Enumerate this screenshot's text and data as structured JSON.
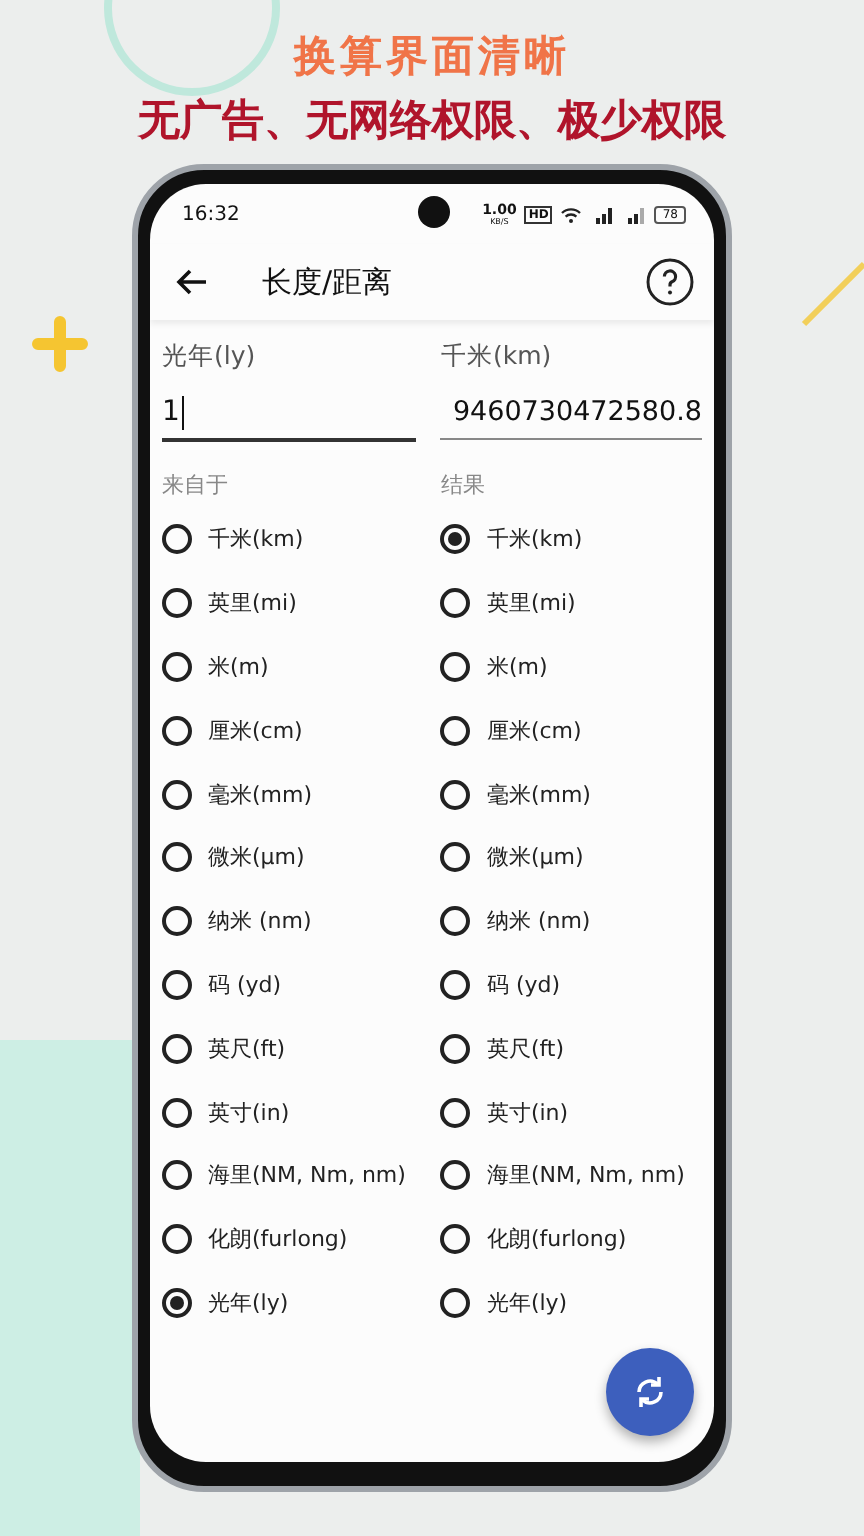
{
  "banner": {
    "title": "换算界面清晰",
    "subtitle": "无广告、无网络权限、极少权限"
  },
  "status_bar": {
    "time": "16:32",
    "speed": "1.00",
    "speed_unit": "KB/S",
    "hd": "HD",
    "battery": "78"
  },
  "app_bar": {
    "title": "长度/距离"
  },
  "from_field": {
    "label": "光年(ly)",
    "value": "1",
    "focused": true
  },
  "to_field": {
    "label": "千米(km)",
    "value": "9460730472580.8",
    "focused": false
  },
  "from_units": {
    "heading": "来自于",
    "options": [
      {
        "label": "千米(km)",
        "selected": false
      },
      {
        "label": "英里(mi)",
        "selected": false
      },
      {
        "label": "米(m)",
        "selected": false
      },
      {
        "label": "厘米(cm)",
        "selected": false
      },
      {
        "label": "毫米(mm)",
        "selected": false
      },
      {
        "label": "微米(μm)",
        "selected": false
      },
      {
        "label": "纳米 (nm)",
        "selected": false
      },
      {
        "label": "码 (yd)",
        "selected": false
      },
      {
        "label": "英尺(ft)",
        "selected": false
      },
      {
        "label": "英寸(in)",
        "selected": false
      },
      {
        "label": "海里(NM, Nm, nm)",
        "selected": false
      },
      {
        "label": "化朗(furlong)",
        "selected": false
      },
      {
        "label": "光年(ly)",
        "selected": true
      }
    ]
  },
  "to_units": {
    "heading": "结果",
    "options": [
      {
        "label": "千米(km)",
        "selected": true
      },
      {
        "label": "英里(mi)",
        "selected": false
      },
      {
        "label": "米(m)",
        "selected": false
      },
      {
        "label": "厘米(cm)",
        "selected": false
      },
      {
        "label": "毫米(mm)",
        "selected": false
      },
      {
        "label": "微米(μm)",
        "selected": false
      },
      {
        "label": "纳米 (nm)",
        "selected": false
      },
      {
        "label": "码 (yd)",
        "selected": false
      },
      {
        "label": "英尺(ft)",
        "selected": false
      },
      {
        "label": "英寸(in)",
        "selected": false
      },
      {
        "label": "海里(NM, Nm, nm)",
        "selected": false
      },
      {
        "label": "化朗(furlong)",
        "selected": false
      },
      {
        "label": "光年(ly)",
        "selected": false
      }
    ]
  }
}
